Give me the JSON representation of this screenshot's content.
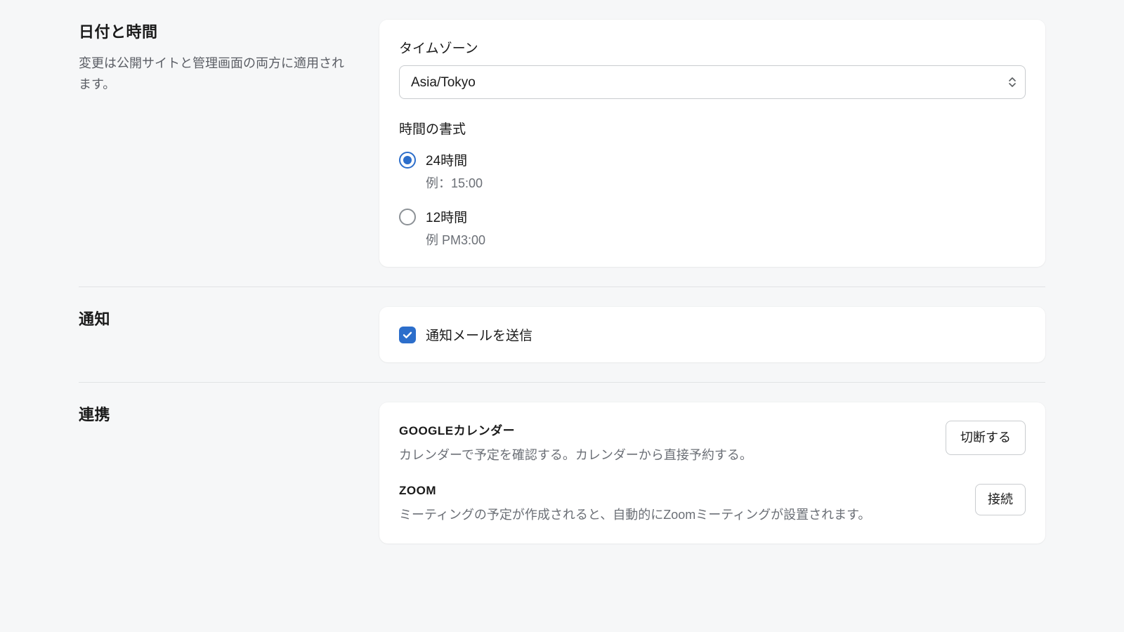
{
  "datetime": {
    "title": "日付と時間",
    "description": "変更は公開サイトと管理画面の両方に適用されます。",
    "timezone_label": "タイムゾーン",
    "timezone_value": "Asia/Tokyo",
    "time_format_label": "時間の書式",
    "options": {
      "h24": {
        "label": "24時間",
        "example": "例：15:00",
        "checked": true
      },
      "h12": {
        "label": "12時間",
        "example": "例 PM3:00",
        "checked": false
      }
    }
  },
  "notifications": {
    "title": "通知",
    "send_email_label": "通知メールを送信",
    "send_email_checked": true
  },
  "integrations": {
    "title": "連携",
    "google": {
      "title": "GOOGLEカレンダー",
      "description": "カレンダーで予定を確認する。カレンダーから直接予約する。",
      "button": "切断する"
    },
    "zoom": {
      "title": "ZOOM",
      "description": "ミーティングの予定が作成されると、自動的にZoomミーティングが設置されます。",
      "button": "接続"
    }
  }
}
